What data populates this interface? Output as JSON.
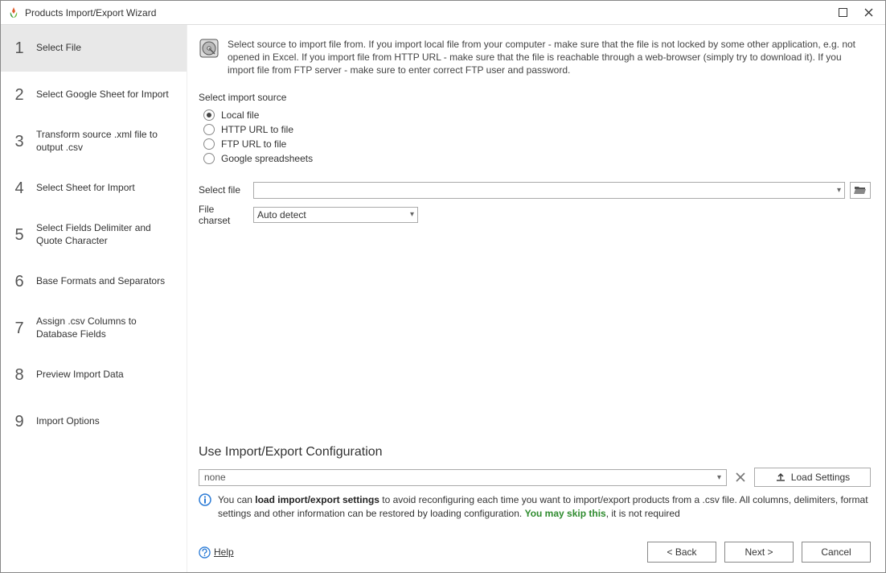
{
  "window": {
    "title": "Products Import/Export Wizard"
  },
  "sidebar": {
    "steps": [
      {
        "num": "1",
        "label": "Select File",
        "active": true
      },
      {
        "num": "2",
        "label": "Select Google Sheet for Import",
        "active": false
      },
      {
        "num": "3",
        "label": "Transform source .xml file to output .csv",
        "active": false
      },
      {
        "num": "4",
        "label": "Select Sheet for Import",
        "active": false
      },
      {
        "num": "5",
        "label": "Select Fields Delimiter and Quote Character",
        "active": false
      },
      {
        "num": "6",
        "label": "Base Formats and Separators",
        "active": false
      },
      {
        "num": "7",
        "label": "Assign .csv Columns to Database Fields",
        "active": false
      },
      {
        "num": "8",
        "label": "Preview Import Data",
        "active": false
      },
      {
        "num": "9",
        "label": "Import Options",
        "active": false
      }
    ]
  },
  "info": {
    "text": "Select source to import file from. If you import local file from your computer - make sure that the file is not locked by some other application, e.g. not opened in Excel. If you import file from HTTP URL - make sure that the file is reachable through a web-browser (simply try to download it). If you import file from FTP server - make sure to enter correct FTP user and password."
  },
  "source": {
    "label": "Select import source",
    "options": {
      "local": "Local file",
      "http": "HTTP URL to file",
      "ftp": "FTP URL to file",
      "google": "Google spreadsheets"
    },
    "selected": "local"
  },
  "file": {
    "label": "Select file",
    "value": ""
  },
  "charset": {
    "label": "File charset",
    "value": "Auto detect"
  },
  "config": {
    "title": "Use Import/Export Configuration",
    "combo_value": "none",
    "load_label": "Load Settings",
    "note_lead": "You can ",
    "note_bold": "load import/export settings",
    "note_mid": " to avoid reconfiguring each time you want to import/export products from a .csv file. All columns, delimiters, format settings and other information can be restored by loading configuration. ",
    "note_skip": "You may skip this",
    "note_tail": ", it is not required"
  },
  "buttons": {
    "help": "Help",
    "back": "< Back",
    "next": "Next >",
    "cancel": "Cancel"
  }
}
